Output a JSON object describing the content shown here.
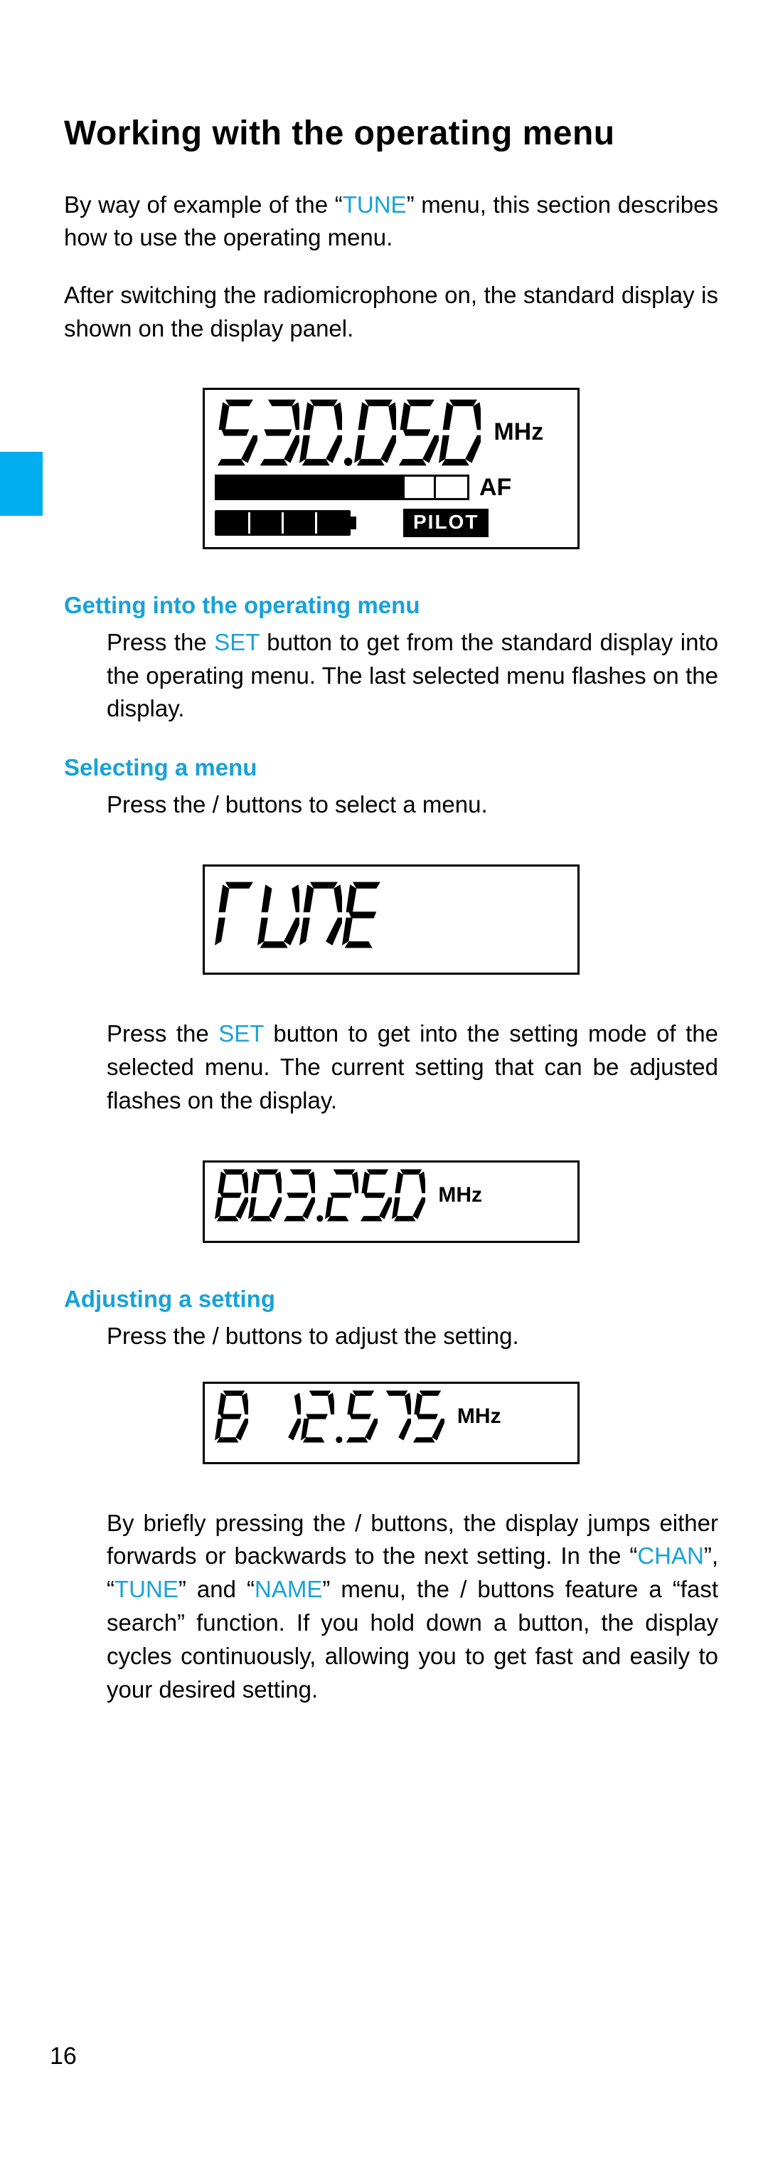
{
  "page": {
    "title": "Working with the operating menu",
    "pageNumber": "16"
  },
  "intro": {
    "p1_prefix": "By way of example of the “",
    "p1_kw": "TUNE",
    "p1_suffix": "” menu, this section describes how to use the operating menu.",
    "p2": "After switching the radiomicrophone on, the standard display is shown on the display panel."
  },
  "display1": {
    "freq_digits": "530.050",
    "unit": "MHz",
    "af_label": "AF",
    "af_levels": [
      true,
      true,
      true,
      true,
      true,
      true,
      false,
      false
    ],
    "batt_cells": 4,
    "pilot": "PILOT"
  },
  "sec_getinto": {
    "title": "Getting into the operating menu",
    "p_before": "Press the ",
    "p_kw": "SET",
    "p_after": " button to get from the standard display into the operating menu. The last selected menu flashes on the display."
  },
  "sec_select": {
    "title": "Selecting a menu",
    "p1": "Press the    /    buttons to select a menu.",
    "tune_word": "TUNE",
    "p2_before": "Press the ",
    "p2_kw": "SET",
    "p2_after": " button to get into the setting mode of the selected menu. The current setting that can be adjusted flashes on the display.",
    "display2_digits": "803.250",
    "display2_unit": "MHz"
  },
  "sec_adjust": {
    "title": "Adjusting a setting",
    "p1": "Press the    /    buttons to adjust the setting.",
    "display3_digits": "8 12.575",
    "display3_unit": "MHz",
    "p2_a": "By briefly pressing the    /    buttons, the display jumps either forwards or backwards to the next setting. In the “",
    "p2_kw1": "CHAN",
    "p2_b": "”, “",
    "p2_kw2": "TUNE",
    "p2_c": "” and “",
    "p2_kw3": "NAME",
    "p2_d": "” menu, the    /    buttons feature a “fast search” function. If you hold down a button, the display cycles continuously, allowing you to get fast and easily to your desired setting."
  }
}
